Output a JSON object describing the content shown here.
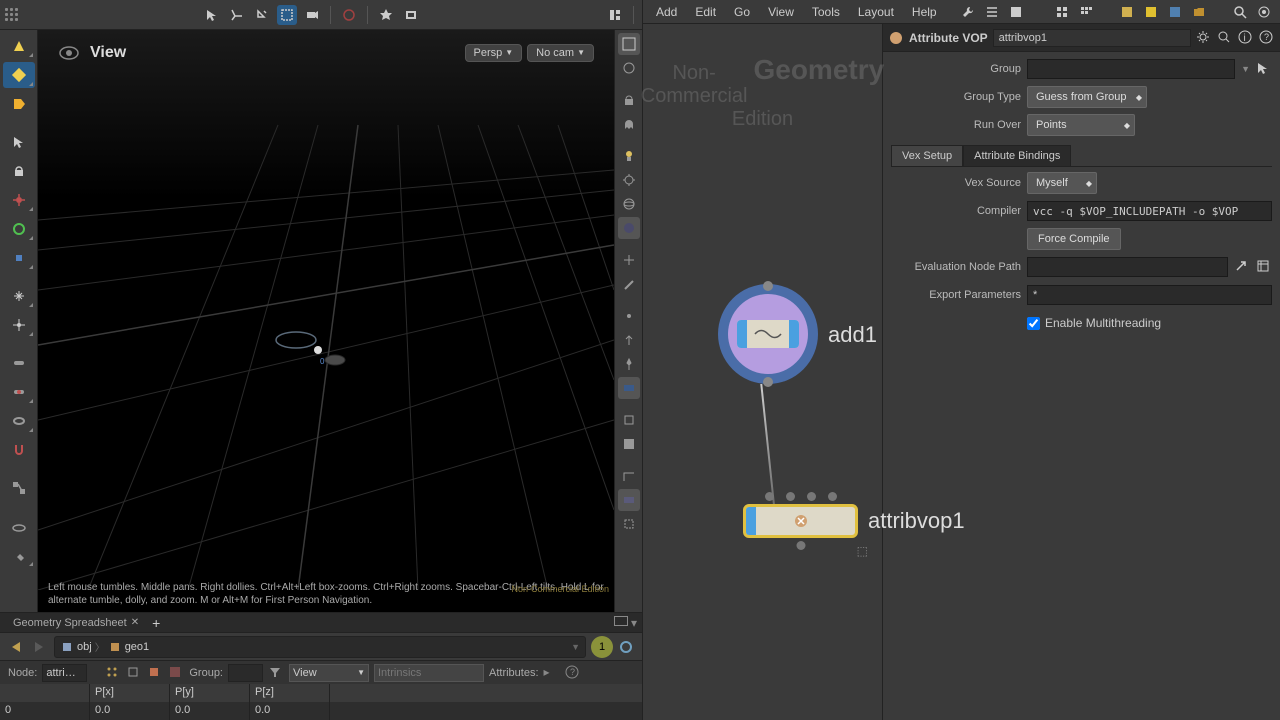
{
  "viewport": {
    "title": "View",
    "persp": "Persp",
    "cam": "No cam",
    "hint": "Left mouse tumbles. Middle pans. Right dollies. Ctrl+Alt+Left box-zooms. Ctrl+Right zooms. Spacebar-Ctrl-Left tilts. Hold L for alternate tumble, dolly, and zoom. M or Alt+M for First Person Navigation.",
    "watermark": "Non-Commercial Edition"
  },
  "spreadsheet": {
    "tab": "Geometry Spreadsheet",
    "path": {
      "seg1": "obj",
      "seg2": "geo1"
    },
    "node_label": "Node:",
    "node_value": "attri…",
    "group_label": "Group:",
    "view_label": "View",
    "intrinsics_label": "Intrinsics",
    "attributes_label": "Attributes:",
    "pin": "1",
    "headers": {
      "idx": "",
      "px": "P[x]",
      "py": "P[y]",
      "pz": "P[z]"
    },
    "row0": {
      "idx": "0",
      "px": "0.0",
      "py": "0.0",
      "pz": "0.0"
    }
  },
  "menu": {
    "add": "Add",
    "edit": "Edit",
    "go": "Go",
    "view": "View",
    "tools": "Tools",
    "layout": "Layout",
    "help": "Help"
  },
  "network": {
    "watermark_big": "Geometry",
    "watermark_small": "Non-Commercial",
    "watermark_small2": "Edition",
    "node1_label": "add1",
    "node2_label": "attribvop1"
  },
  "params": {
    "type": "Attribute VOP",
    "name": "attribvop1",
    "group_label": "Group",
    "group_type_label": "Group Type",
    "group_type_value": "Guess from Group",
    "run_over_label": "Run Over",
    "run_over_value": "Points",
    "tab1": "Vex Setup",
    "tab2": "Attribute Bindings",
    "vex_source_label": "Vex Source",
    "vex_source_value": "Myself",
    "compiler_label": "Compiler",
    "compiler_value": "vcc -q $VOP_INCLUDEPATH -o $VOP",
    "force_compile": "Force Compile",
    "eval_path_label": "Evaluation Node Path",
    "export_params_label": "Export Parameters",
    "export_params_value": "*",
    "multithread_label": "Enable Multithreading"
  }
}
